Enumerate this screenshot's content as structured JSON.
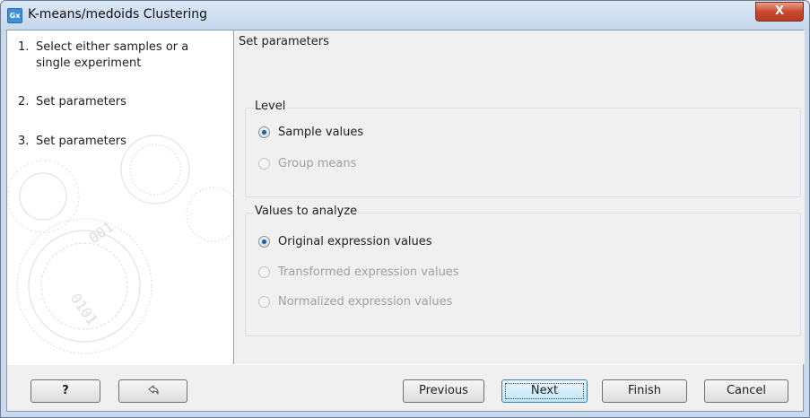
{
  "window": {
    "title": "K-means/medoids Clustering",
    "app_icon_text": "Gx",
    "close_glyph": "X"
  },
  "sidebar": {
    "steps": [
      {
        "num": "1.",
        "label": "Select either samples or a single experiment"
      },
      {
        "num": "2.",
        "label": "Set parameters"
      },
      {
        "num": "3.",
        "label": "Set parameters"
      }
    ]
  },
  "main": {
    "section_title": "Set parameters",
    "level_group": {
      "legend": "Level",
      "options": [
        {
          "label": "Sample values",
          "selected": true,
          "enabled": true
        },
        {
          "label": "Group means",
          "selected": false,
          "enabled": false
        }
      ]
    },
    "values_group": {
      "legend": "Values to analyze",
      "options": [
        {
          "label": "Original expression values",
          "selected": true,
          "enabled": true
        },
        {
          "label": "Transformed expression values",
          "selected": false,
          "enabled": false
        },
        {
          "label": "Normalized expression values",
          "selected": false,
          "enabled": false
        }
      ]
    }
  },
  "buttons": {
    "help": "?",
    "reset_icon": "reset-icon",
    "previous": "Previous",
    "next": "Next",
    "finish": "Finish",
    "cancel": "Cancel"
  },
  "colors": {
    "title_bar": "#c6d8ee",
    "close_button": "#c74a30",
    "radio_selected": "#1e5ea8",
    "default_button": "#bee6fd"
  }
}
